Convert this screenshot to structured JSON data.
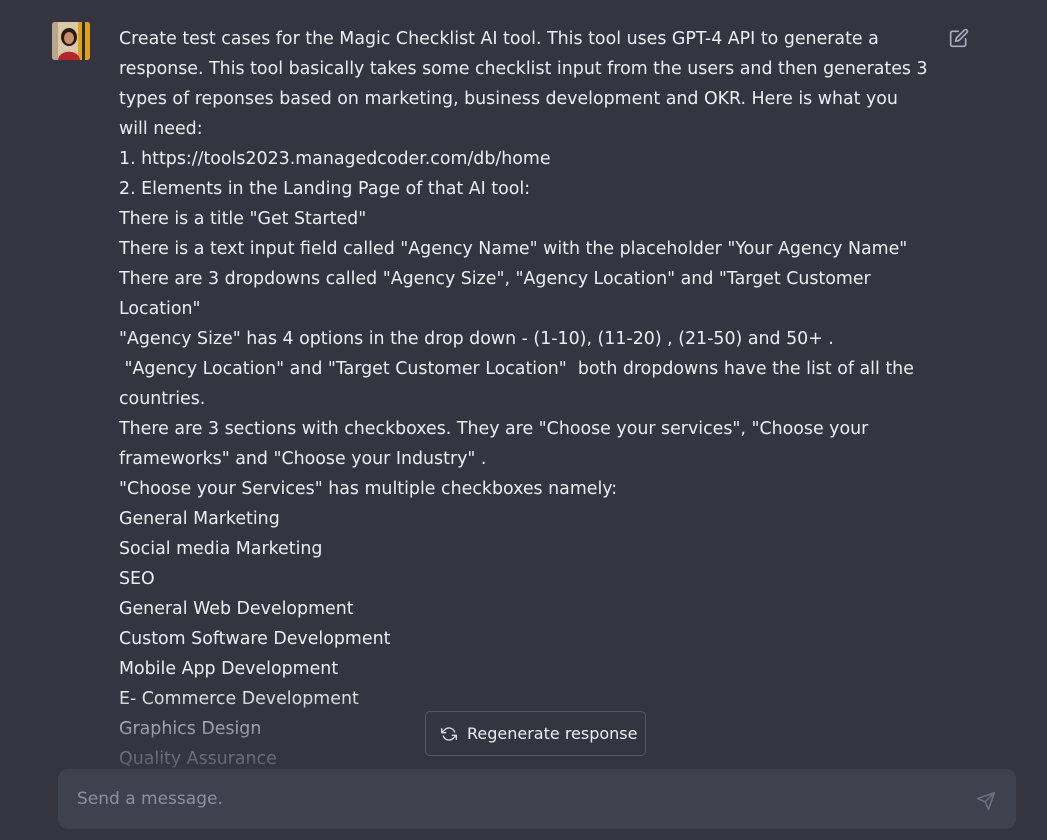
{
  "message": {
    "avatar_icon": "user-avatar-photo",
    "lines": [
      "Create test cases for the Magic Checklist AI tool. This tool uses GPT-4 API to generate a",
      "response. This tool basically takes some checklist input from the users and then generates 3",
      "types of reponses based on marketing, business development and OKR. Here is what you",
      "will need:",
      "1. https://tools2023.managedcoder.com/db/home",
      "2. Elements in the Landing Page of that AI tool:",
      "There is a title \"Get Started\"",
      "There is a text input field called \"Agency Name\" with the placeholder \"Your Agency Name\"",
      "There are 3 dropdowns called \"Agency Size\", \"Agency Location\" and \"Target Customer",
      "Location\"",
      "\"Agency Size\" has 4 options in the drop down - (1-10), (11-20) , (21-50) and 50+ .",
      " \"Agency Location\" and \"Target Customer Location\"  both dropdowns have the list of all the",
      "countries.",
      "There are 3 sections with checkboxes. They are \"Choose your services\", \"Choose your",
      "frameworks\" and \"Choose your Industry\" .",
      "\"Choose your Services\" has multiple checkboxes namely:",
      "General Marketing",
      "Social media Marketing",
      "SEO",
      "General Web Development",
      "Custom Software Development",
      "Mobile App Development",
      "E- Commerce Development",
      "Graphics Design",
      "Quality Assurance"
    ],
    "edit_icon": "edit-icon"
  },
  "regenerate": {
    "label": "Regenerate response",
    "icon": "refresh-icon"
  },
  "composer": {
    "placeholder": "Send a message.",
    "value": "",
    "send_icon": "send-icon"
  },
  "colors": {
    "background": "#343541",
    "input_background": "#40414f",
    "text": "#ececf1",
    "muted": "#8e8ea0",
    "border": "#565869"
  }
}
